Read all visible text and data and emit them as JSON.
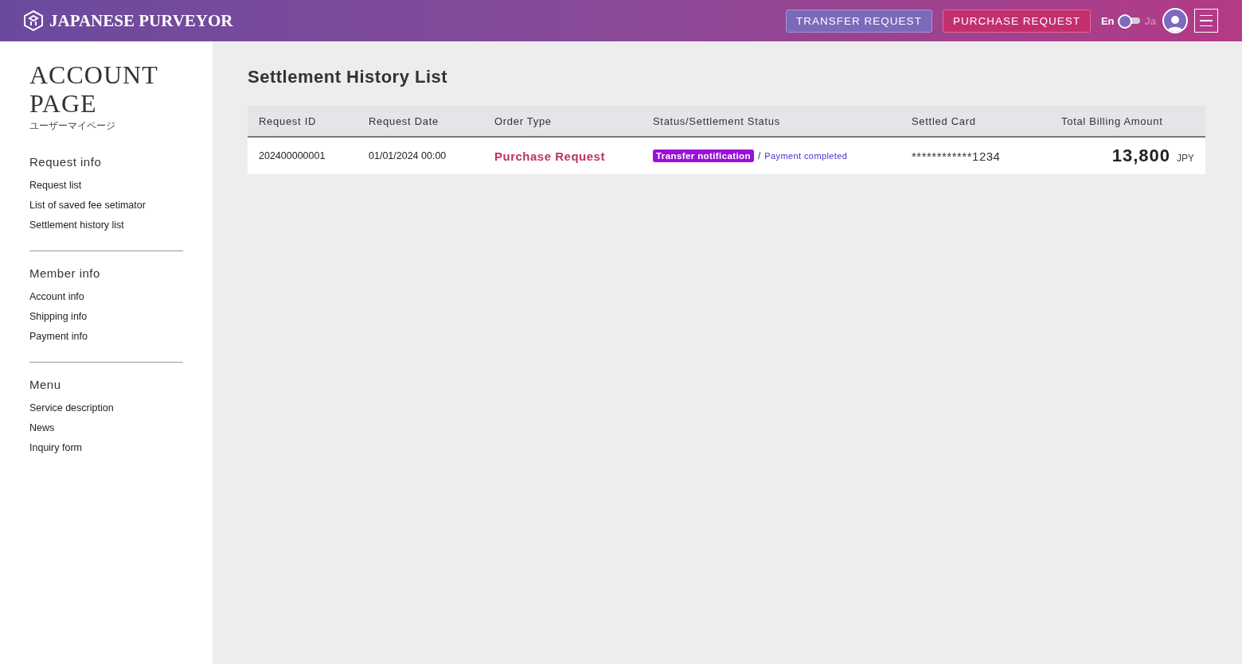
{
  "header": {
    "brand": "JAPANESE PURVEYOR",
    "buttons": [
      {
        "label": "TRANSFER REQUEST",
        "kind": "transfer"
      },
      {
        "label": "PURCHASE REQUEST",
        "kind": "purchase"
      }
    ],
    "languages": [
      {
        "label": "En",
        "selected": true
      },
      {
        "label": "Ja",
        "selected": false
      }
    ]
  },
  "sidebar": {
    "title": "ACCOUNT PAGE",
    "subtitle": "ユーザーマイページ",
    "sections": [
      {
        "heading": "Request info",
        "items": [
          "Request list",
          "List of saved fee setimator",
          "Settlement history list"
        ]
      },
      {
        "heading": "Member info",
        "items": [
          "Account info",
          "Shipping info",
          "Payment info"
        ]
      },
      {
        "heading": "Menu",
        "items": [
          "Service description",
          "News",
          "Inquiry form"
        ]
      }
    ]
  },
  "main": {
    "title": "Settlement History List",
    "table": {
      "columns": [
        "Request ID",
        "Request Date",
        "Order Type",
        "Status/Settlement Status",
        "Settled Card",
        "Total Billing Amount"
      ],
      "rows": [
        {
          "request_id": "202400000001",
          "request_date": "01/01/2024 00:00",
          "order_type": "Purchase Request",
          "status_badge": "Transfer notification",
          "separator": "/",
          "settlement_status": "Payment completed",
          "card": "************1234",
          "amount": "13,800",
          "currency": "JPY"
        }
      ]
    }
  }
}
